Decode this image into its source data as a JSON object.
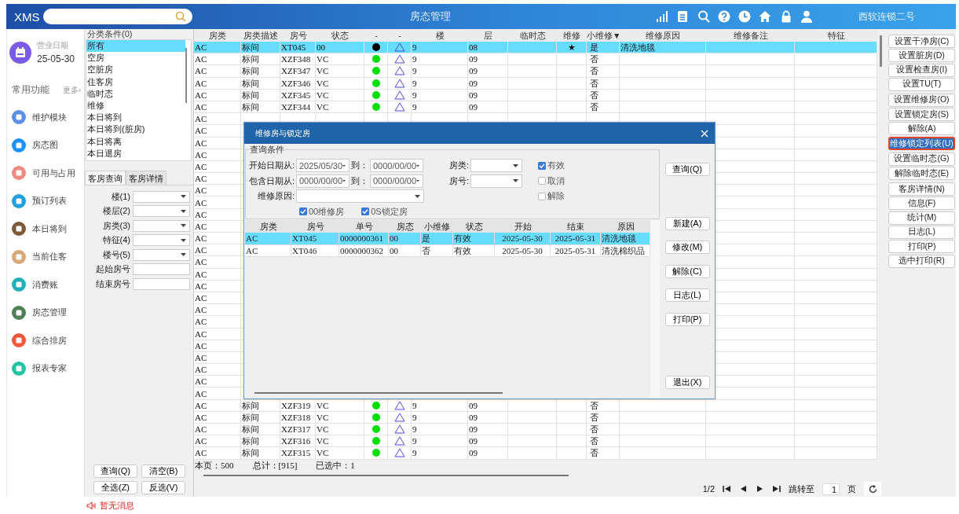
{
  "header": {
    "logo": "XMS",
    "title": "房态管理",
    "hotel": "西软连锁二号"
  },
  "nav": {
    "date_label": "营业日期",
    "date": "25-05-30",
    "section": "常用功能",
    "more": "更多›",
    "items": [
      {
        "label": "维护模块",
        "color": "#5b8fe8"
      },
      {
        "label": "房态图",
        "color": "#1e90ff"
      },
      {
        "label": "可用与占用",
        "color": "#ef8a80"
      },
      {
        "label": "预订列表",
        "color": "#20a0e0"
      },
      {
        "label": "本日将到",
        "color": "#7d5a3c"
      },
      {
        "label": "当前住客",
        "color": "#d9a878"
      },
      {
        "label": "消费账",
        "color": "#22b0b8"
      },
      {
        "label": "房态管理",
        "color": "#4f7f55"
      },
      {
        "label": "综合排房",
        "color": "#f0583c"
      },
      {
        "label": "报表专家",
        "color": "#22c4a4"
      }
    ]
  },
  "filter": {
    "title": "分类条件(0)",
    "categories": [
      {
        "label": "所有",
        "selected": true
      },
      {
        "label": "空房",
        "selected": false
      },
      {
        "label": "空脏房",
        "selected": false
      },
      {
        "label": "住客房",
        "selected": false
      },
      {
        "label": "临时态",
        "selected": false
      },
      {
        "label": "维修",
        "selected": false
      },
      {
        "label": "本日将到",
        "selected": false
      },
      {
        "label": "本日将到(脏房)",
        "selected": false
      },
      {
        "label": "本日将离",
        "selected": false
      },
      {
        "label": "本日退房",
        "selected": false
      }
    ],
    "tabs": [
      {
        "label": "客房查询",
        "selected": true
      },
      {
        "label": "客房详情",
        "selected": false
      }
    ],
    "fields": [
      {
        "label": "楼(1)",
        "kind": "select"
      },
      {
        "label": "楼层(2)",
        "kind": "select"
      },
      {
        "label": "房类(3)",
        "kind": "select"
      },
      {
        "label": "特征(4)",
        "kind": "select"
      },
      {
        "label": "楼号(5)",
        "kind": "select"
      },
      {
        "label": "起始房号",
        "kind": "input"
      },
      {
        "label": "结束房号",
        "kind": "input"
      }
    ],
    "buttons": [
      "查询(Q)",
      "清空(B)",
      "全选(Z)",
      "反选(V)"
    ]
  },
  "grid": {
    "columns": [
      "房类",
      "房类描述",
      "房号",
      "状态",
      "-",
      "-",
      "楼",
      "层",
      "临时态",
      "维修",
      "小维修▼",
      "维修原因",
      "维修备注",
      "特征"
    ],
    "rows": [
      {
        "type": "AC",
        "desc": "标间",
        "room": "XT045",
        "status": "00",
        "color": "#000000",
        "building": "9",
        "floor": "08",
        "repair": "★",
        "minor": "是",
        "reason": "清洗地毯",
        "selected": true
      },
      {
        "type": "AC",
        "desc": "标间",
        "room": "XZF348",
        "status": "VC",
        "color": "#00e000",
        "building": "9",
        "floor": "09",
        "minor": "否",
        "selected": false
      },
      {
        "type": "AC",
        "desc": "标间",
        "room": "XZF347",
        "status": "VC",
        "color": "#00e000",
        "building": "9",
        "floor": "09",
        "minor": "否",
        "selected": false
      },
      {
        "type": "AC",
        "desc": "标间",
        "room": "XZF346",
        "status": "VC",
        "color": "#00e000",
        "building": "9",
        "floor": "09",
        "minor": "否",
        "selected": false
      },
      {
        "type": "AC",
        "desc": "标间",
        "room": "XZF345",
        "status": "VC",
        "color": "#00e000",
        "building": "9",
        "floor": "09",
        "minor": "否",
        "selected": false
      },
      {
        "type": "AC",
        "desc": "标间",
        "room": "XZF344",
        "status": "VC",
        "color": "#00e000",
        "building": "9",
        "floor": "09",
        "minor": "否",
        "selected": false
      },
      {
        "type": "AC",
        "selected": false
      },
      {
        "type": "AC",
        "selected": false
      },
      {
        "type": "AC",
        "selected": false
      },
      {
        "type": "AC",
        "selected": false
      },
      {
        "type": "AC",
        "selected": false
      },
      {
        "type": "AC",
        "selected": false
      },
      {
        "type": "AC",
        "selected": false
      },
      {
        "type": "AC",
        "selected": false
      },
      {
        "type": "AC",
        "selected": false
      },
      {
        "type": "AC",
        "selected": false
      },
      {
        "type": "AC",
        "selected": false
      },
      {
        "type": "AC",
        "selected": false
      },
      {
        "type": "AC",
        "selected": false
      },
      {
        "type": "AC",
        "selected": false
      },
      {
        "type": "AC",
        "selected": false
      },
      {
        "type": "AC",
        "selected": false
      },
      {
        "type": "AC",
        "selected": false
      },
      {
        "type": "AC",
        "selected": false
      },
      {
        "type": "AC",
        "selected": false
      },
      {
        "type": "AC",
        "selected": false
      },
      {
        "type": "AC",
        "selected": false
      },
      {
        "type": "AC",
        "selected": false
      },
      {
        "type": "AC",
        "selected": false
      },
      {
        "type": "AC",
        "selected": false
      },
      {
        "type": "AC",
        "desc": "标间",
        "room": "XZF319",
        "status": "VC",
        "color": "#00e000",
        "building": "9",
        "floor": "09",
        "minor": "否",
        "selected": false
      },
      {
        "type": "AC",
        "desc": "标间",
        "room": "XZF318",
        "status": "VC",
        "color": "#00e000",
        "building": "9",
        "floor": "09",
        "minor": "否",
        "selected": false
      },
      {
        "type": "AC",
        "desc": "标间",
        "room": "XZF317",
        "status": "VC",
        "color": "#00e000",
        "building": "9",
        "floor": "09",
        "minor": "否",
        "selected": false
      },
      {
        "type": "AC",
        "desc": "标间",
        "room": "XZF316",
        "status": "VC",
        "color": "#00e000",
        "building": "9",
        "floor": "09",
        "minor": "否",
        "selected": false
      },
      {
        "type": "AC",
        "desc": "标间",
        "room": "XZF315",
        "status": "VC",
        "color": "#00e000",
        "building": "9",
        "floor": "09",
        "minor": "否",
        "selected": false
      }
    ],
    "summary": [
      "本页：500",
      "总计：[915]",
      "已选中：1"
    ],
    "pager": {
      "page": "1/2",
      "goto_label": "跳转至",
      "goto_value": "1",
      "unit": "页"
    }
  },
  "actions": [
    [
      {
        "label": "设置干净房(C)",
        "selected": false
      },
      {
        "label": "设置脏房(D)",
        "selected": false
      },
      {
        "label": "设置检查房(I)",
        "selected": false
      },
      {
        "label": "设置TU(T)",
        "selected": false
      }
    ],
    [
      {
        "label": "设置维修房(O)",
        "selected": false
      },
      {
        "label": "设置锁定房(S)",
        "selected": false
      },
      {
        "label": "解除(A)",
        "selected": false
      },
      {
        "label": "维修锁定列表(U)",
        "selected": true
      }
    ],
    [
      {
        "label": "设置临时态(G)",
        "selected": false
      },
      {
        "label": "解除临时态(E)",
        "selected": false
      }
    ],
    [
      {
        "label": "客房详情(N)",
        "selected": false
      },
      {
        "label": "信息(F)",
        "selected": false
      },
      {
        "label": "统计(M)",
        "selected": false
      },
      {
        "label": "日志(L)",
        "selected": false
      },
      {
        "label": "打印(P)",
        "selected": false
      },
      {
        "label": "选中打印(R)",
        "selected": false
      }
    ]
  ],
  "dialog": {
    "title": "维修房与锁定房",
    "group_title": "查询条件",
    "date_rows": [
      {
        "label": "开始日期从:",
        "from": "2025/05/30",
        "to_label": "到：",
        "to": "0000/00/00"
      },
      {
        "label": "包含日期从:",
        "from": "0000/00/00",
        "to_label": "到：",
        "to": "0000/00/00"
      }
    ],
    "reason_label": "维修原因:",
    "room_type_label": "房类:",
    "room_label": "房号:",
    "status_checks": [
      {
        "label": "有效",
        "checked": true
      },
      {
        "label": "取消",
        "checked": false
      },
      {
        "label": "解除",
        "checked": false
      }
    ],
    "type_checks": [
      {
        "label": "00维修房",
        "checked": true
      },
      {
        "label": "0S锁定房",
        "checked": true
      }
    ],
    "columns": [
      "房类",
      "房号",
      "单号",
      "房态",
      "小维修",
      "状态",
      "开始",
      "结束",
      "原因"
    ],
    "rows": [
      {
        "cells": [
          "AC",
          "XT045",
          "0000000361",
          "00",
          "是",
          "有效",
          "2025-05-30",
          "2025-05-31",
          "清洗地毯"
        ],
        "selected": true
      },
      {
        "cells": [
          "AC",
          "XT046",
          "0000000362",
          "00",
          "否",
          "有效",
          "2025-05-30",
          "2025-05-31",
          "清洗棉织品"
        ],
        "selected": false
      }
    ],
    "buttons": [
      "查询(Q)",
      "新建(A)",
      "修改(M)",
      "解除(C)",
      "日志(L)",
      "打印(P)",
      "退出(X)"
    ]
  },
  "message": "暂无消息"
}
